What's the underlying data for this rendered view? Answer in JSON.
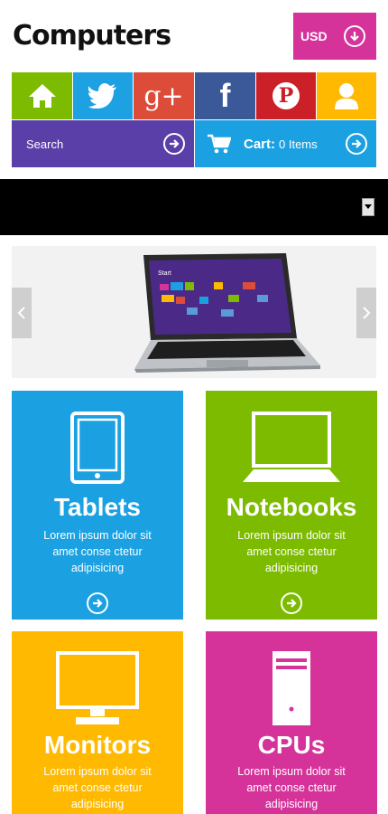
{
  "header": {
    "logo": "Computers",
    "currency_label": "USD"
  },
  "social": [
    {
      "name": "home-icon",
      "color": "#7cbb00"
    },
    {
      "name": "twitter-icon",
      "color": "#1da1e2"
    },
    {
      "name": "google-plus-icon",
      "color": "#dd4b39",
      "glyph": "g+"
    },
    {
      "name": "facebook-icon",
      "color": "#3b5998",
      "glyph": "f"
    },
    {
      "name": "pinterest-icon",
      "color": "#cb2027",
      "glyph": "P"
    },
    {
      "name": "user-icon",
      "color": "#ffb900"
    }
  ],
  "search": {
    "label": "Search",
    "color": "#5b3fa8"
  },
  "cart": {
    "label": "Cart:",
    "count_text": "0 Items",
    "color": "#1ba1e2"
  },
  "tiles": [
    {
      "title": "Tablets",
      "text": "Lorem ipsum dolor sit amet conse ctetur adipisicing",
      "color": "#1ba1e2"
    },
    {
      "title": "Notebooks",
      "text": "Lorem ipsum dolor sit amet conse ctetur adipisicing",
      "color": "#7cbb00"
    },
    {
      "title": "Monitors",
      "text": "Lorem ipsum dolor sit amet conse ctetur adipisicing",
      "color": "#ffb900"
    },
    {
      "title": "CPUs",
      "text": "Lorem ipsum dolor sit amet conse ctetur adipisicing",
      "color": "#d6339a"
    }
  ],
  "slider": {
    "laptop_screen_text": "Start"
  }
}
